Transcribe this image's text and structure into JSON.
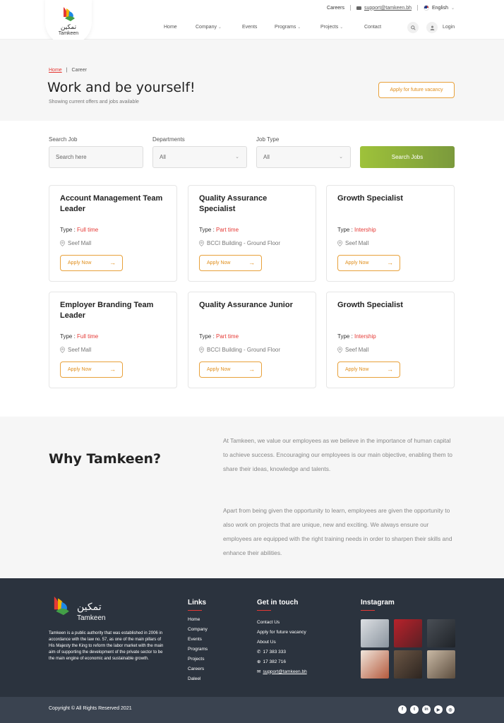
{
  "header": {
    "brand_arabic": "تمكين",
    "brand_latin": "Tamkeen",
    "topbar": {
      "careers": "Careers",
      "email": "support@tamkeen.bh",
      "language": "English"
    },
    "nav": [
      "Home",
      "Company",
      "Events",
      "Programs",
      "Projects",
      "Contact"
    ],
    "login": "Login"
  },
  "hero": {
    "breadcrumb_home": "Home",
    "breadcrumb_sep": "|",
    "breadcrumb_current": "Career",
    "title": "Work and be yourself!",
    "subtitle": "Showing current offers and jobs available",
    "future_button": "Apply for future vacancy"
  },
  "filters": {
    "search_label": "Search Job",
    "search_placeholder": "Search here",
    "departments_label": "Departments",
    "departments_value": "All",
    "jobtype_label": "Job Type",
    "jobtype_value": "All",
    "search_button": "Search Jobs"
  },
  "jobs": [
    {
      "title": "Account Management Team Leader",
      "type_label": "Type : ",
      "type": "Full time",
      "location": "Seef Mall",
      "apply": "Apply Now"
    },
    {
      "title": "Quality Assurance Specialist",
      "type_label": "Type : ",
      "type": "Part time",
      "location": "BCCI Building - Ground Floor",
      "apply": "Apply Now"
    },
    {
      "title": "Growth Specialist",
      "type_label": "Type : ",
      "type": "Intership",
      "location": "Seef Mall",
      "apply": "Apply Now"
    },
    {
      "title": "Employer Branding Team Leader",
      "type_label": "Type : ",
      "type": "Full time",
      "location": "Seef Mall",
      "apply": "Apply Now"
    },
    {
      "title": "Quality Assurance Junior",
      "type_label": "Type : ",
      "type": "Part time",
      "location": "BCCI Building - Ground Floor",
      "apply": "Apply Now"
    },
    {
      "title": "Growth Specialist",
      "type_label": "Type : ",
      "type": "Intership",
      "location": "Seef Mall",
      "apply": "Apply Now"
    }
  ],
  "why": {
    "title": "Why Tamkeen?",
    "p1": "At Tamkeen, we value our employees as we believe in the importance of human capital to achieve success. Encouraging our employees is our main objective, enabling them to share their ideas, knowledge and talents.",
    "p2": "Apart from being given the opportunity to learn, employees are given the opportunity to also work on projects that are unique, new and exciting. We always ensure our employees are equipped with the right training needs in order to sharpen their skills and enhance their abilities."
  },
  "footer": {
    "about": "Tamkeen is a public authority that was established in 2006 in accordance with the law no. 57, as one of the main pillars of His Majesty the King to reform the labor market with the main aim of supporting the development of the private sector to be the main engine of economic and sustainable growth.",
    "links_title": "Links",
    "links": [
      "Home",
      "Company",
      "Events",
      "Programs",
      "Projects",
      "Careers",
      "Daleel"
    ],
    "contact_title": "Get in touch",
    "contact_links": [
      "Contact Us",
      "Apply for future vacancy",
      "About Us"
    ],
    "phone": "17 383 333",
    "fax": "17 382 716",
    "email": "support@tamkeen.bh",
    "instagram_title": "Instagram",
    "copyright": "Copyright © All Rights Reserved 2021"
  },
  "colors": {
    "accent_red": "#e53935",
    "accent_orange": "#e08e1b",
    "search_green": "#8fb03b",
    "footer_bg": "#2b333e"
  }
}
